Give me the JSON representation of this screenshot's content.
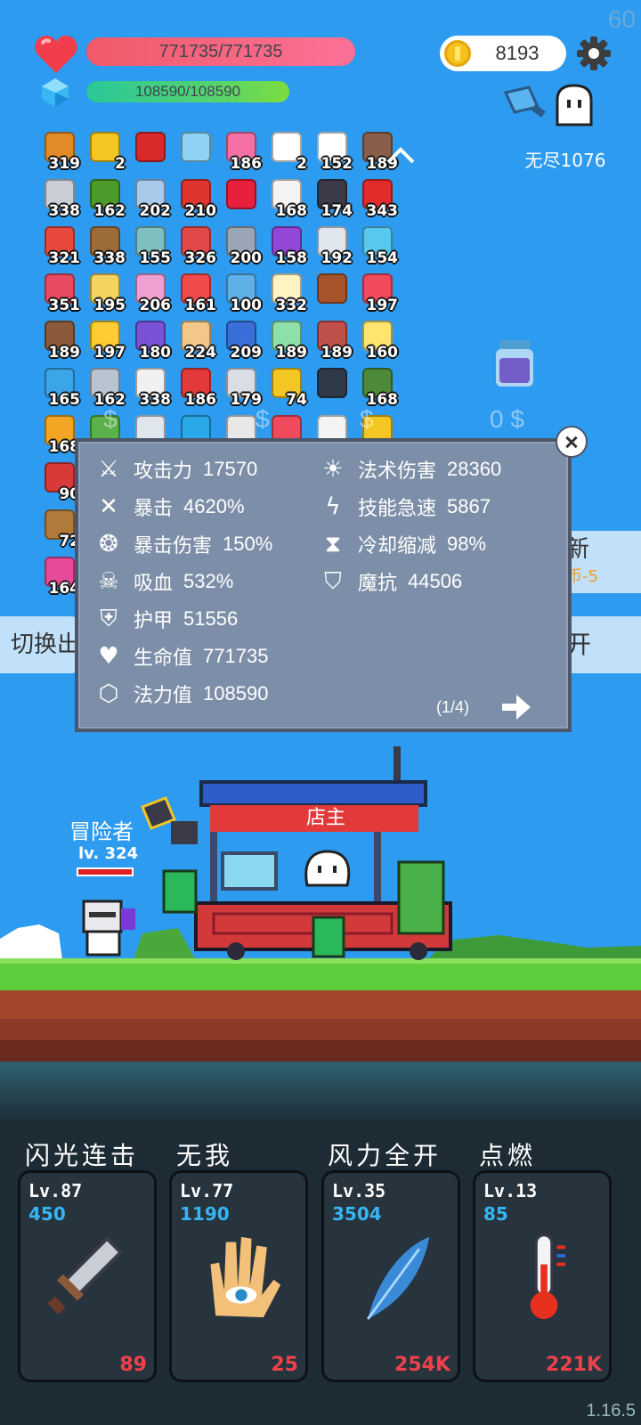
{
  "fps": "60",
  "version": "1.16.5",
  "player": {
    "hp_text": "771735/771735",
    "hp_fraction": 1.0,
    "mp_text": "108590/108590",
    "mp_fraction": 1.0,
    "coins": "8193",
    "endless_label": "无尽1076"
  },
  "items": [
    {
      "icon": "book-icon",
      "color": "#e08a28",
      "count": "319"
    },
    {
      "icon": "crown-icon",
      "color": "#f3c623",
      "count": "2"
    },
    {
      "icon": "magnet-icon",
      "color": "#d82a2a",
      "count": ""
    },
    {
      "icon": "magnifier-icon",
      "color": "#8fd3f4",
      "count": ""
    },
    {
      "icon": "ice-cream-icon",
      "color": "#f36fa4",
      "count": "186"
    },
    {
      "icon": "cloud-icon",
      "color": "#ffffff",
      "count": "2"
    },
    {
      "icon": "ghost-icon",
      "color": "#ffffff",
      "count": "152"
    },
    {
      "icon": "tombstone-icon",
      "color": "#8a5c4a",
      "count": "189"
    },
    {
      "icon": "sword-icon",
      "color": "#c9ced6",
      "count": "338"
    },
    {
      "icon": "helmet-icon",
      "color": "#4c9a2a",
      "count": "162"
    },
    {
      "icon": "cat-icon",
      "color": "#a9c9ea",
      "count": "202"
    },
    {
      "icon": "mushroom-icon",
      "color": "#e0342f",
      "count": "210"
    },
    {
      "icon": "ruby-icon",
      "color": "#e8203e",
      "count": ""
    },
    {
      "icon": "card-icon",
      "color": "#f4f4f4",
      "count": "168"
    },
    {
      "icon": "cauldron-icon",
      "color": "#3a3a48",
      "count": "174"
    },
    {
      "icon": "apple-icon",
      "color": "#e22b2b",
      "count": "343"
    },
    {
      "icon": "watermelon-icon",
      "color": "#e8493f",
      "count": "321"
    },
    {
      "icon": "shield-round-icon",
      "color": "#9b6b3a",
      "count": "338"
    },
    {
      "icon": "ring-icon",
      "color": "#7fbfc0",
      "count": "155"
    },
    {
      "icon": "boot-icon",
      "color": "#e24848",
      "count": "326"
    },
    {
      "icon": "gauntlet-icon",
      "color": "#9aa6b6",
      "count": "200"
    },
    {
      "icon": "potion-icon",
      "color": "#9347d8",
      "count": "158"
    },
    {
      "icon": "cloud-gray-icon",
      "color": "#e0e6ee",
      "count": "192"
    },
    {
      "icon": "scroll-icon",
      "color": "#57c9f0",
      "count": "154"
    },
    {
      "icon": "jar-icon",
      "color": "#e84a62",
      "count": "351"
    },
    {
      "icon": "note-icon",
      "color": "#f4d35e",
      "count": "195"
    },
    {
      "icon": "spray-icon",
      "color": "#f0a0d0",
      "count": "206"
    },
    {
      "icon": "pill-icon",
      "color": "#f04a4a",
      "count": "161"
    },
    {
      "icon": "target-icon",
      "color": "#5fb0e8",
      "count": "100"
    },
    {
      "icon": "egg-icon",
      "color": "#fff3c4",
      "count": "332"
    },
    {
      "icon": "chest-icon",
      "color": "#a8542a",
      "count": ""
    },
    {
      "icon": "heart-icon",
      "color": "#f04a5c",
      "count": "197"
    },
    {
      "icon": "coconut-icon",
      "color": "#8a5a3a",
      "count": "189"
    },
    {
      "icon": "fried-egg-icon",
      "color": "#ffcc33",
      "count": "197"
    },
    {
      "icon": "star-shield-icon",
      "color": "#7a52d6",
      "count": "180"
    },
    {
      "icon": "hand-icon",
      "color": "#f3c68a",
      "count": "224"
    },
    {
      "icon": "blue-shield-icon",
      "color": "#3a6ed8",
      "count": "209"
    },
    {
      "icon": "slime-icon",
      "color": "#8de0a8",
      "count": "189"
    },
    {
      "icon": "guitar-icon",
      "color": "#c0504a",
      "count": "189"
    },
    {
      "icon": "halo-icon",
      "color": "#ffe46e",
      "count": "160"
    },
    {
      "icon": "chat-icon",
      "color": "#3aa6e8",
      "count": "165"
    },
    {
      "icon": "saw-icon",
      "color": "#b8c4d0",
      "count": "162"
    },
    {
      "icon": "star-card-icon",
      "color": "#f0f0f0",
      "count": "338"
    },
    {
      "icon": "gift-icon",
      "color": "#e23a3a",
      "count": "186"
    },
    {
      "icon": "compass-icon",
      "color": "#d8dde6",
      "count": "179"
    },
    {
      "icon": "gold-ring-icon",
      "color": "#f3c623",
      "count": "74"
    },
    {
      "icon": "hood-icon",
      "color": "#2f3a48",
      "count": ""
    },
    {
      "icon": "grenade-icon",
      "color": "#4c8a3a",
      "count": "168"
    },
    {
      "icon": "sunflower-icon",
      "color": "#f3a623",
      "count": "168"
    },
    {
      "icon": "zombie-icon",
      "color": "#5ab04a",
      "count": ""
    },
    {
      "icon": "clipboard-icon",
      "color": "#e0e6ee",
      "count": ""
    },
    {
      "icon": "crystal-icon",
      "color": "#28a8e8",
      "count": ""
    },
    {
      "icon": "feather-icon",
      "color": "#e8e8e8",
      "count": ""
    },
    {
      "icon": "heart-card-icon",
      "color": "#f04a5c",
      "count": ""
    },
    {
      "icon": "mail-icon",
      "color": "#f4f4f4",
      "count": ""
    },
    {
      "icon": "lamp-icon",
      "color": "#f3c623",
      "count": ""
    },
    {
      "icon": "key-icon",
      "color": "#d83a3a",
      "count": "90"
    },
    {
      "icon": "bow-icon",
      "color": "#b07a3a",
      "count": "72"
    },
    {
      "icon": "card-pink-icon",
      "color": "#e84a9a",
      "count": "164"
    }
  ],
  "stats": [
    {
      "icon": "attack-icon",
      "label": "攻击力",
      "value": "17570"
    },
    {
      "icon": "crit-icon",
      "label": "暴击",
      "value": "4620%"
    },
    {
      "icon": "crit-damage-icon",
      "label": "暴击伤害",
      "value": "150%"
    },
    {
      "icon": "lifesteal-icon",
      "label": "吸血",
      "value": "532%"
    },
    {
      "icon": "armor-icon",
      "label": "护甲",
      "value": "51556"
    },
    {
      "icon": "health-icon",
      "label": "生命值",
      "value": "771735"
    },
    {
      "icon": "mana-icon",
      "label": "法力值",
      "value": "108590"
    },
    {
      "icon": "magic-damage-icon",
      "label": "法术伤害",
      "value": "28360"
    },
    {
      "icon": "ability-haste-icon",
      "label": "技能急速",
      "value": "5867"
    },
    {
      "icon": "cooldown-icon",
      "label": "冷却缩减",
      "value": "98%"
    },
    {
      "icon": "magic-resist-icon",
      "label": "魔抗",
      "value": "44506"
    }
  ],
  "panel_page": "(1/4)",
  "side": {
    "left_label": "切换出",
    "right_label": "开",
    "new_label": "新",
    "new_sub": "币-5"
  },
  "scene": {
    "adventurer_name": "冒险者",
    "adventurer_level": "lv. 324",
    "shop_sign": "店主",
    "dollar": "$",
    "dollar_amount": "0 $"
  },
  "skills": [
    {
      "title": "闪光连击",
      "level": "Lv.87",
      "power": "450",
      "cost": "89",
      "icon": "sword-icon"
    },
    {
      "title": "无我",
      "level": "Lv.77",
      "power": "1190",
      "cost": "25",
      "icon": "eye-hand-icon"
    },
    {
      "title": "风力全开",
      "level": "Lv.35",
      "power": "3504",
      "cost": "254K",
      "icon": "feather-icon"
    },
    {
      "title": "点燃",
      "level": "Lv.13",
      "power": "85",
      "cost": "221K",
      "icon": "thermometer-icon"
    }
  ]
}
